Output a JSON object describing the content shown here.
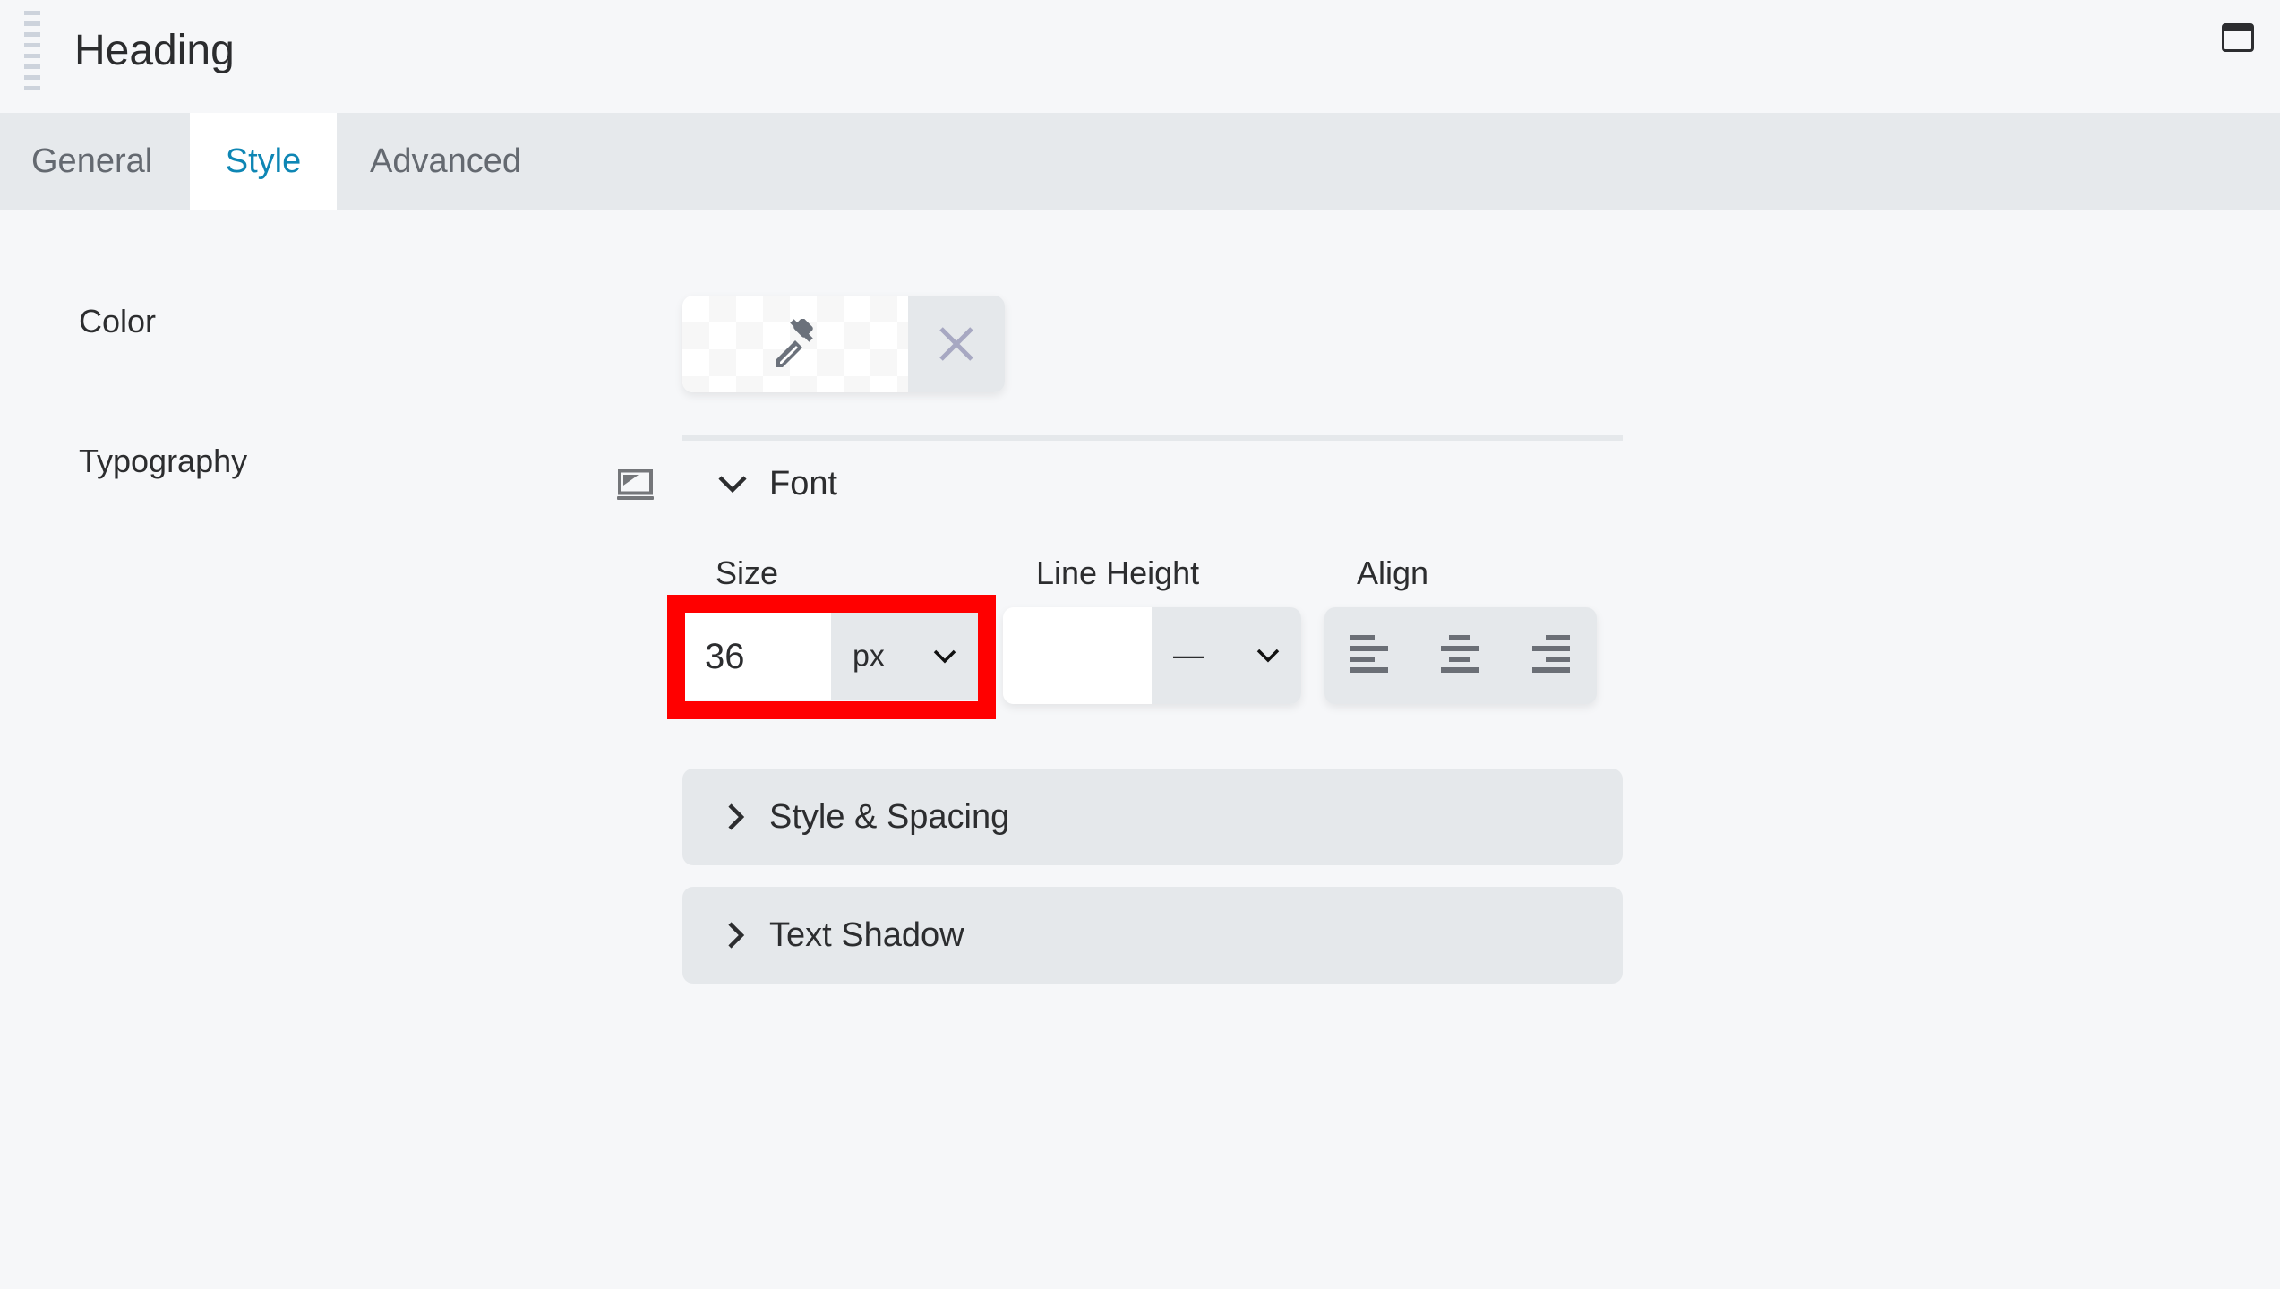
{
  "header": {
    "title": "Heading",
    "drag_icon": "drag-handle-icon",
    "window_icon": "window-toggle-icon"
  },
  "tabs": [
    {
      "label": "General",
      "active": false
    },
    {
      "label": "Style",
      "active": true
    },
    {
      "label": "Advanced",
      "active": false
    }
  ],
  "colors": {
    "accent": "#0e86b4",
    "background": "#f6f7f9",
    "tabbar": "#e6e9ec",
    "control_bg": "#e5e8eb",
    "highlight": "#ff0000",
    "icon": "#6b6f76",
    "clear_icon": "#a7a8c2"
  },
  "style": {
    "color": {
      "label": "Color",
      "value": "",
      "picker_icon": "eyedropper-icon",
      "clear_icon": "close-icon"
    },
    "typography": {
      "label": "Typography",
      "responsive_icon": "laptop-icon",
      "font_section": {
        "label": "Font",
        "expanded": true,
        "size": {
          "label": "Size",
          "value": "36",
          "unit": "px"
        },
        "line_height": {
          "label": "Line Height",
          "value": "",
          "unit": "—"
        },
        "align": {
          "label": "Align",
          "options": [
            "left",
            "center",
            "right"
          ]
        }
      },
      "sections": [
        {
          "label": "Style & Spacing",
          "expanded": false
        },
        {
          "label": "Text Shadow",
          "expanded": false
        }
      ]
    }
  }
}
